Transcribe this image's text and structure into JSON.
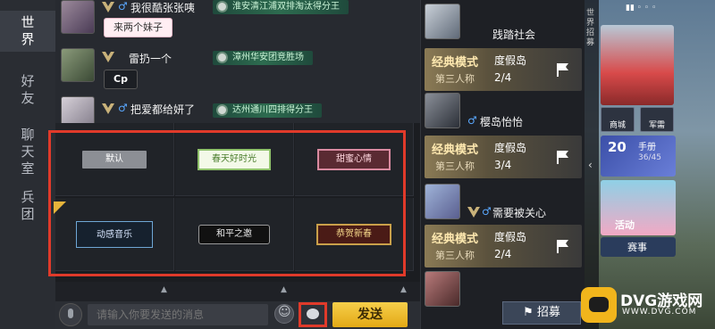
{
  "sidebar": {
    "tabs": [
      {
        "label": "世界",
        "active": true
      },
      {
        "label": "好友",
        "active": false
      },
      {
        "label": "聊天室",
        "active": false
      },
      {
        "label": "兵团",
        "active": false
      }
    ]
  },
  "chat": {
    "messages": [
      {
        "name": "我很酷张张咦",
        "title": "淮安清江浦双排淘汰得分王",
        "bubble": "来两个妹子"
      },
      {
        "name": "雷扔一个",
        "title": "漳州华安团竞胜场",
        "bubble": "Cp"
      },
      {
        "name": "把爱都给妍了",
        "title": "达州通川四排得分王"
      }
    ]
  },
  "bubble_picker": {
    "styles": [
      {
        "label": "默认"
      },
      {
        "label": "春天好时光"
      },
      {
        "label": "甜蜜心情"
      },
      {
        "label": "动感音乐"
      },
      {
        "label": "和平之邀"
      },
      {
        "label": "恭贺新春"
      }
    ]
  },
  "input": {
    "placeholder": "请输入你要发送的消息",
    "send_label": "发送"
  },
  "teams": {
    "list": [
      {
        "leader": "践踏社会",
        "mode": "经典模式",
        "perspective": "第三人称",
        "map": "度假岛",
        "count": "2/4"
      },
      {
        "leader": "樱岛怡怡",
        "mode": "经典模式",
        "perspective": "第三人称",
        "map": "度假岛",
        "count": "3/4"
      },
      {
        "leader": "需要被关心",
        "mode": "经典模式",
        "perspective": "第三人称",
        "map": "度假岛",
        "count": "2/4"
      }
    ],
    "recruit_label": "招募"
  },
  "right_panel": {
    "strip_label": "世界招募",
    "mini_buttons": [
      "商城",
      "军需"
    ],
    "pass": {
      "level": "20",
      "label": "手册",
      "progress": "36/45"
    },
    "event_label": "活动",
    "match_label": "赛事"
  },
  "watermark": {
    "text": "DVG游戏网",
    "url": "WWW.DVG.COM"
  },
  "colors": {
    "highlight_red": "#e03a2a",
    "send_yellow": "#f6cf4a",
    "title_green": "#2d6b4f"
  }
}
